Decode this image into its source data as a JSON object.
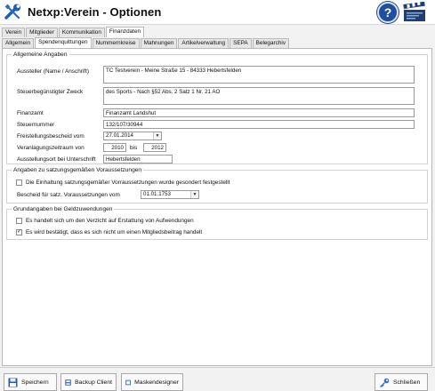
{
  "window": {
    "title": "Netxp:Verein - Optionen"
  },
  "header_icons": [
    "wrench-icon",
    "help-icon",
    "clapperboard-icon"
  ],
  "help_label": "?",
  "tabs_top": [
    "Verein",
    "Mitglieder",
    "Kommunikation",
    "Finanzdaten"
  ],
  "tabs_top_active": "Finanzdaten",
  "tabs_sub": [
    "Allgemein",
    "Spendenquittungen",
    "Nummernkreise",
    "Mahnungen",
    "Artikelverwaltung",
    "SEPA",
    "Belegarchiv"
  ],
  "tabs_sub_active": "Spendenquittungen",
  "allgemein": {
    "title": "Allgemeine Angaben",
    "aussteller_label": "Aussteller (Name / Anschrift)",
    "aussteller_value": "TC Testverein - Meine Straße 15 - 84333 Hebertsfelden",
    "zweck_label": "Steuerbegünstigter Zweck",
    "zweck_value": "des Sports - Nach §52 Abs. 2 Satz 1 Nr. 21 AO",
    "finanzamt_label": "Finanzamt",
    "finanzamt_value": "Finanzamt Landshut",
    "steuernummer_label": "Steuernummer",
    "steuernummer_value": "132/107/30944",
    "freistellung_label": "Freistellungsbescheid vom",
    "freistellung_value": "27.01.2014",
    "zeitraum_label": "Veranlagungszeitraum von",
    "zeitraum_from": "2010",
    "zeitraum_bis": "bis",
    "zeitraum_to": "2012",
    "ort_label": "Ausstellungsort bei Unterschrift",
    "ort_value": "Hebertsfelden"
  },
  "satzung": {
    "title": "Angaben zu satzungsgemäßen Voraussetzungen",
    "checkbox_label": "Die Einhaltung satzungsgemäßer Vorraussetzungen wurde gesondert festgestellt",
    "checkbox_checked": false,
    "bescheid_label": "Bescheid für satz. Voraussetzungen vom",
    "bescheid_value": "01.01.1753"
  },
  "geld": {
    "title": "Grundangaben bei Geldzuwendungen",
    "verzicht_label": "Es handelt sich um den Verzicht auf Erstattung von Aufwendungen",
    "verzicht_checked": false,
    "mitglied_label": "Es wird bestätigt, dass es sich nicht um einen Mitgliedsbeitrag handelt",
    "mitglied_checked": true,
    "check_mark": "✓"
  },
  "footer": {
    "save": "Speichern",
    "backup": "Backup Client",
    "masken": "Maskendesigner",
    "close": "Schließen"
  },
  "colors": {
    "accent": "#1e4f9c",
    "border": "#9b9b9b"
  }
}
